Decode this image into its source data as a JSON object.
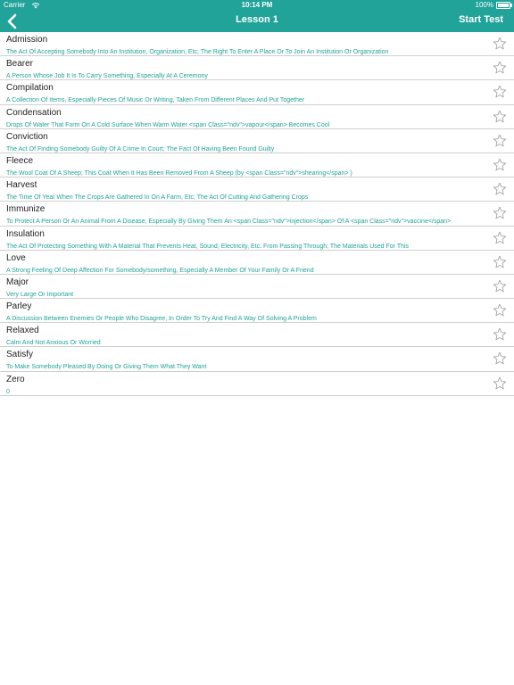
{
  "status": {
    "carrier": "Carrier",
    "time": "10:14 PM",
    "battery": "100%",
    "battery_level": 1.0
  },
  "nav": {
    "title": "Lesson 1",
    "action": "Start Test"
  },
  "icons": {
    "back": "chevron-left-icon",
    "favorite": "star-outline-icon",
    "wifi": "wifi-icon"
  },
  "colors": {
    "accent": "#21a39a",
    "divider": "#cfcfcf",
    "star": "#9a9a9a"
  },
  "words": [
    {
      "word": "Admission",
      "definition": "The Act Of Accepting Somebody Into An Institution, Organization, Etc; The Right To Enter A Place Or To Join An Institution Or Organization"
    },
    {
      "word": "Bearer",
      "definition": "A Person Whose Job It Is To Carry Something, Especially At A Ceremony"
    },
    {
      "word": "Compilation",
      "definition": "A Collection Of Items, Especially Pieces Of Music Or Writing, Taken From Different Places And Put Together"
    },
    {
      "word": "Condensation",
      "definition": "Drops Of Water That Form On A Cold Surface When Warm Water <span Class=\"ndv\">vapour</span> Becomes Cool"
    },
    {
      "word": "Conviction",
      "definition": "The Act Of Finding Somebody Guilty Of A Crime In Court; The Fact Of Having Been Found Guilty"
    },
    {
      "word": "Fleece",
      "definition": "The Wool Coat Of A Sheep; This Coat When It Has Been Removed From A Sheep (by <span Class=\"ndv\">shearing</span> )"
    },
    {
      "word": "Harvest",
      "definition": "The Time Of Year When The Crops Are Gathered In On A Farm, Etc; The Act Of Cutting And Gathering Crops"
    },
    {
      "word": "Immunize",
      "definition": "To Protect A Person Or An Animal From A Disease, Especially By Giving Them An <span Class=\"ndv\">injection</span> Of A <span Class=\"ndv\">vaccine</span>"
    },
    {
      "word": "Insulation",
      "definition": "The Act Of Protecting Something With A Material That Prevents Heat, Sound, Electricity, Etc. From Passing Through; The Materials Used For This"
    },
    {
      "word": "Love",
      "definition": "A Strong Feeling Of Deep Affection For Somebody/something, Especially A Member Of Your Family Or A Friend"
    },
    {
      "word": "Major",
      "definition": "Very Large Or Important"
    },
    {
      "word": "Parley",
      "definition": "A Discussion Between Enemies Or People Who Disagree, In Order To Try And Find A Way Of Solving A Problem"
    },
    {
      "word": "Relaxed",
      "definition": "Calm And Not Anxious Or Worried"
    },
    {
      "word": "Satisfy",
      "definition": "To Make Somebody Pleased By Doing Or Giving Them What They Want"
    },
    {
      "word": "Zero",
      "definition": "0"
    }
  ]
}
